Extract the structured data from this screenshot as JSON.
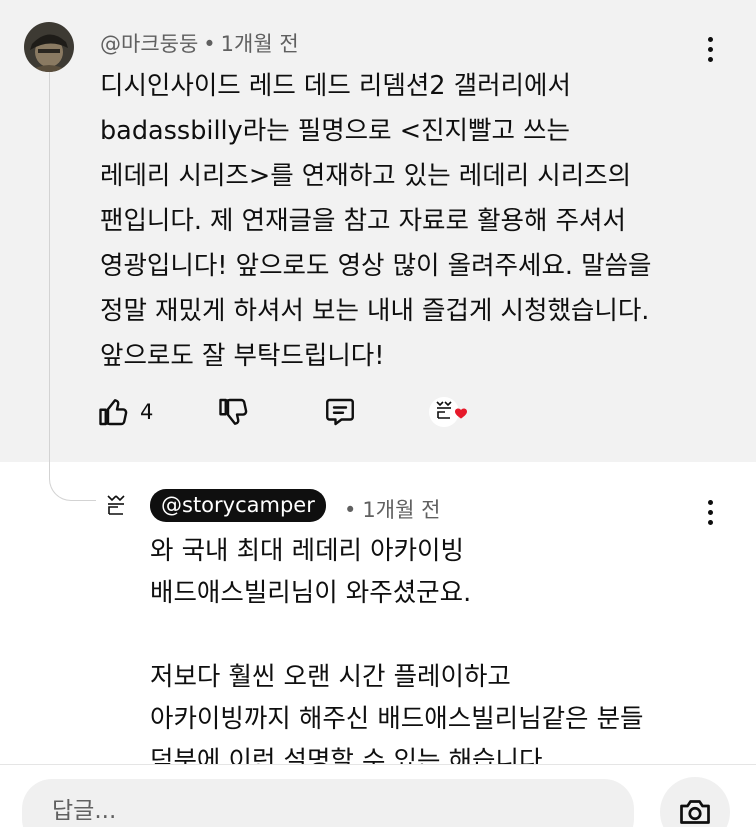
{
  "comment": {
    "author": "@마크둥둥",
    "separator": "•",
    "time": "1개월 전",
    "lines": [
      "디시인사이드 레드 데드 리뎀션2 갤러리에서",
      "badassbilly라는 필명으로 <진지빨고 쓰는",
      "레데리 시리즈>를 연재하고 있는 레데리 시리즈의",
      "팬입니다. 제 연재글을 참고 자료로 활용해 주셔서",
      "영광입니다! 앞으로도 영상 많이 올려주세요. 말씀을",
      "정말 재밌게 하셔서 보는 내내 즐겁게 시청했습니다.",
      "앞으로도 잘 부탁드립니다!"
    ],
    "like_count": "4",
    "icons": {
      "like": "thumbs-up-icon",
      "dislike": "thumbs-down-icon",
      "reply": "reply-icon",
      "creator_heart": "creator-heart-icon",
      "more": "more-vertical-icon"
    }
  },
  "reply": {
    "author": "@storycamper",
    "separator": "•",
    "time": "1개월 전",
    "lines": [
      "와 국내 최대 레데리 아카이빙",
      "배드애스빌리님이 와주셨군요.",
      "",
      "저보다 훨씬 오랜 시간 플레이하고",
      "아카이빙까지 해주신 배드애스빌리님같은 분들",
      "덕분에 이런 설명할 수 있는 해습니다"
    ]
  },
  "composer": {
    "placeholder": "답글...",
    "camera_icon": "camera-icon"
  },
  "colors": {
    "highlight_bg": "#f2f2f2",
    "meta_text": "#606060",
    "heart": "#e6192a",
    "pill_bg": "#0f0f0f"
  }
}
